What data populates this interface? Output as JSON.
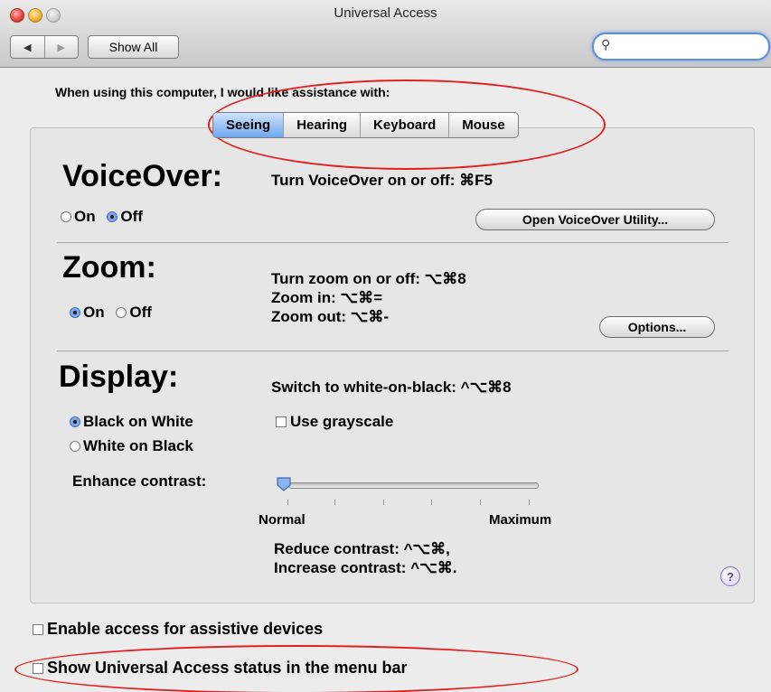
{
  "window": {
    "title": "Universal Access"
  },
  "toolbar": {
    "back": "◀",
    "forward": "▶",
    "show_all": "Show All",
    "search_placeholder": ""
  },
  "intro": "When using this computer, I would like assistance with:",
  "tabs": [
    "Seeing",
    "Hearing",
    "Keyboard",
    "Mouse"
  ],
  "voiceover": {
    "heading": "VoiceOver:",
    "shortcut": "Turn VoiceOver on or off: ⌘F5",
    "on_label": "On",
    "off_label": "Off",
    "selected": "Off",
    "utility_button": "Open VoiceOver Utility..."
  },
  "zoom": {
    "heading": "Zoom:",
    "on_label": "On",
    "off_label": "Off",
    "selected": "On",
    "shortcut1": "Turn zoom on or off: ⌥⌘8",
    "shortcut2": "Zoom in: ⌥⌘=",
    "shortcut3": "Zoom out: ⌥⌘-",
    "options_button": "Options..."
  },
  "display": {
    "heading": "Display:",
    "shortcut": "Switch to white-on-black: ^⌥⌘8",
    "black_on_white": "Black on White",
    "white_on_black": "White on Black",
    "selected": "Black on White",
    "grayscale": "Use grayscale",
    "enhance_label": "Enhance contrast:",
    "slider_min": "Normal",
    "slider_max": "Maximum",
    "slider_value": 0,
    "reduce": "Reduce contrast: ^⌥⌘,",
    "increase": "Increase contrast: ^⌥⌘."
  },
  "help": "?",
  "bottom": {
    "assistive": "Enable access for assistive devices",
    "status_menu": "Show Universal Access status in the menu bar"
  },
  "annotation_color": "#e21f1f"
}
